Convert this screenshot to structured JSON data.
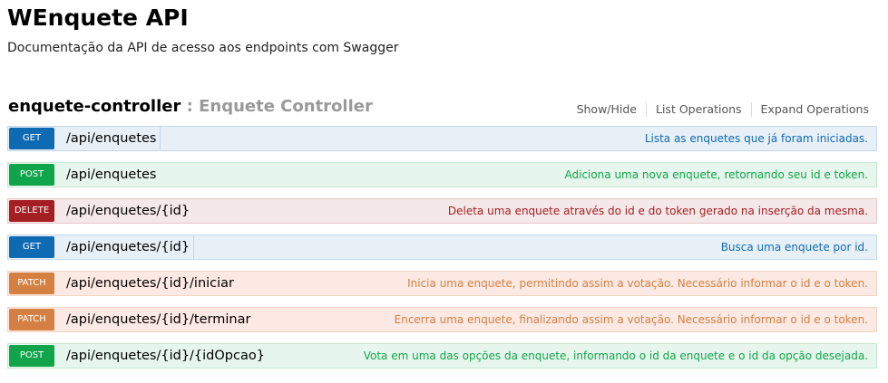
{
  "header": {
    "title": "WEnquete API",
    "subtitle": "Documentação da API de acesso aos endpoints com Swagger"
  },
  "controller": {
    "name": "enquete-controller",
    "separator": " : ",
    "description": "Enquete Controller",
    "links": {
      "show_hide": "Show/Hide",
      "list_operations": "List Operations",
      "expand_operations": "Expand Operations"
    }
  },
  "operations": [
    {
      "method": "GET",
      "path": "/api/enquetes",
      "summary": "Lista as enquetes que já foram iniciadas."
    },
    {
      "method": "POST",
      "path": "/api/enquetes",
      "summary": "Adiciona uma nova enquete, retornando seu id e token."
    },
    {
      "method": "DELETE",
      "path": "/api/enquetes/{id}",
      "summary": "Deleta uma enquete através do id e do token gerado na inserção da mesma."
    },
    {
      "method": "GET",
      "path": "/api/enquetes/{id}",
      "summary": "Busca uma enquete por id."
    },
    {
      "method": "PATCH",
      "path": "/api/enquetes/{id}/iniciar",
      "summary": "Inicia uma enquete, permitindo assim a votação. Necessário informar o id e o token."
    },
    {
      "method": "PATCH",
      "path": "/api/enquetes/{id}/terminar",
      "summary": "Encerra uma enquete, finalizando assim a votação. Necessário informar o id e o token."
    },
    {
      "method": "POST",
      "path": "/api/enquetes/{id}/{idOpcao}",
      "summary": "Vota em uma das opções da enquete, informando o id da enquete e o id da opção desejada."
    }
  ],
  "colors": {
    "get": "#0f6ab4",
    "post": "#10a54a",
    "delete": "#a41e22",
    "patch": "#d38042"
  }
}
